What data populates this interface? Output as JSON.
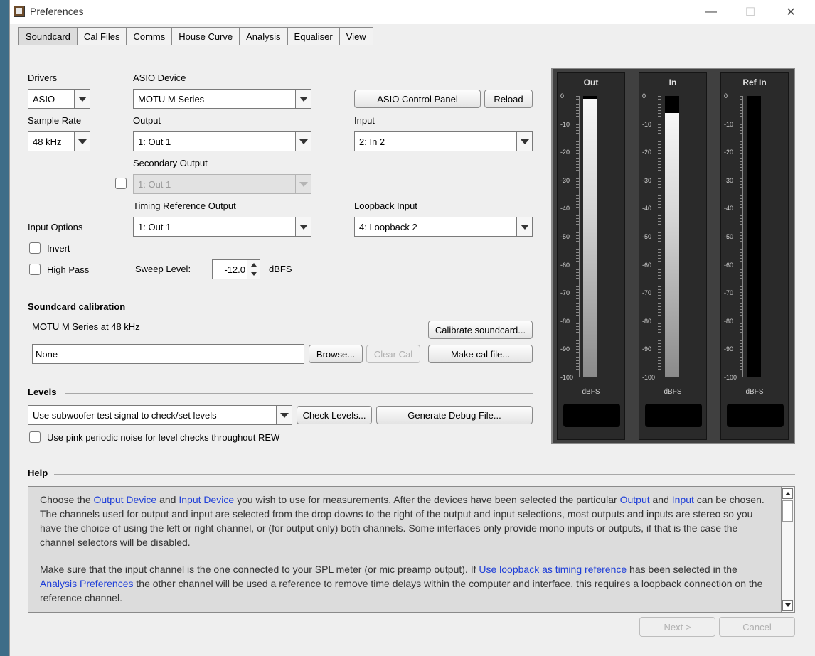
{
  "window": {
    "title": "Preferences"
  },
  "tabs": [
    "Soundcard",
    "Cal Files",
    "Comms",
    "House Curve",
    "Analysis",
    "Equaliser",
    "View"
  ],
  "soundcard": {
    "drivers_label": "Drivers",
    "drivers_value": "ASIO",
    "asio_device_label": "ASIO Device",
    "asio_device_value": "MOTU M Series",
    "asio_control_panel_button": "ASIO Control Panel",
    "reload_button": "Reload",
    "sample_rate_label": "Sample Rate",
    "sample_rate_value": "48 kHz",
    "output_label": "Output",
    "output_value": "1: Out 1",
    "input_label": "Input",
    "input_value": "2: In 2",
    "secondary_output_label": "Secondary Output",
    "secondary_output_value": "1: Out 1",
    "timing_reference_output_label": "Timing Reference Output",
    "timing_reference_output_value": "1: Out 1",
    "loopback_input_label": "Loopback Input",
    "loopback_input_value": "4: Loopback 2",
    "input_options_label": "Input Options",
    "invert_label": "Invert",
    "high_pass_label": "High Pass",
    "sweep_level_label": "Sweep Level:",
    "sweep_level_value": "-12.0",
    "sweep_level_unit": "dBFS"
  },
  "calibration": {
    "section_title": "Soundcard calibration",
    "device_info": "MOTU M Series at 48 kHz",
    "calibrate_button": "Calibrate soundcard...",
    "cal_file_value": "None",
    "browse_button": "Browse...",
    "clear_cal_button": "Clear Cal",
    "make_cal_file_button": "Make cal file..."
  },
  "levels": {
    "section_title": "Levels",
    "method_value": "Use subwoofer test signal to check/set levels",
    "check_levels_button": "Check Levels...",
    "generate_debug_button": "Generate Debug File...",
    "pink_noise_label": "Use pink periodic noise for level checks throughout REW"
  },
  "meters": {
    "ticks": [
      "0",
      "-10",
      "-20",
      "-30",
      "-40",
      "-50",
      "-60",
      "-70",
      "-80",
      "-90",
      "-100"
    ],
    "unit": "dBFS",
    "scale_min": -100,
    "scale_max": 0,
    "channels": [
      {
        "name": "Out",
        "level_dbfs": -1
      },
      {
        "name": "In",
        "level_dbfs": -6
      },
      {
        "name": "Ref In",
        "level_dbfs": -100
      }
    ]
  },
  "help": {
    "section_title": "Help",
    "p1": [
      {
        "t": "Choose the "
      },
      {
        "t": "Output Device",
        "link": true
      },
      {
        "t": " and "
      },
      {
        "t": "Input Device",
        "link": true
      },
      {
        "t": " you wish to use for measurements. After the devices have been selected the particular "
      },
      {
        "t": "Output",
        "link": true
      },
      {
        "t": " and "
      },
      {
        "t": "Input",
        "link": true
      },
      {
        "t": " can be chosen. The channels used for output and input are selected from the drop downs to the right of the output and input selections, most outputs and inputs are stereo so you have the choice of using the left or right channel, or (for output only) both channels. Some interfaces only provide mono inputs or outputs, if that is the case the channel selectors will be disabled."
      }
    ],
    "p2": [
      {
        "t": "Make sure that the input channel is the one connected to your SPL meter (or mic preamp output). If "
      },
      {
        "t": "Use loopback as timing reference",
        "link": true
      },
      {
        "t": " has been selected in the "
      },
      {
        "t": "Analysis Preferences",
        "link": true
      },
      {
        "t": " the other channel will be used a reference to remove time delays within the computer and interface, this requires a loopback connection on the reference channel."
      }
    ]
  },
  "footer": {
    "next_button": "Next >",
    "cancel_button": "Cancel"
  }
}
